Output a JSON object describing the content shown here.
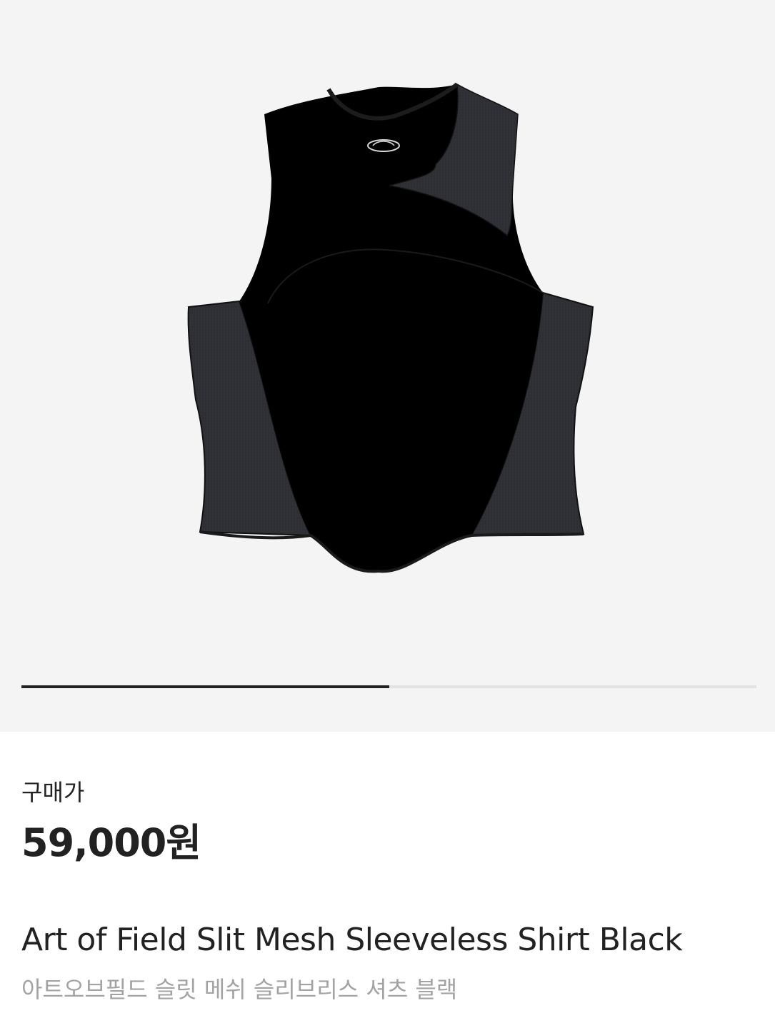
{
  "gallery": {
    "image_alt": "Art of Field Slit Mesh Sleeveless Shirt Black",
    "progress": 0.5,
    "colors": {
      "background": "#f4f4f4",
      "track": "#e2e2e2",
      "fill": "#222222"
    }
  },
  "price": {
    "label": "구매가",
    "value": "59,000원"
  },
  "product": {
    "name_en": "Art of Field Slit Mesh Sleeveless Shirt Black",
    "name_ko": "아트오브필드 슬릿 메쉬 슬리브리스 셔츠 블랙"
  }
}
